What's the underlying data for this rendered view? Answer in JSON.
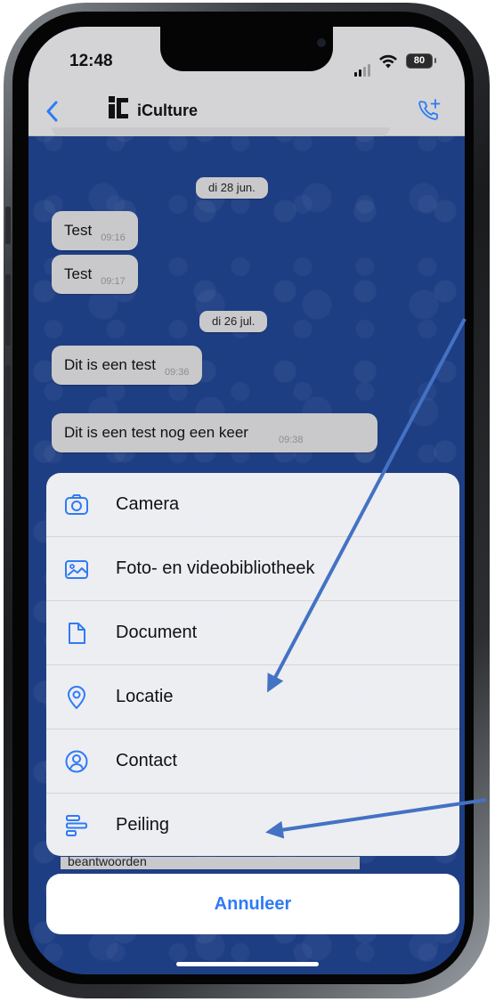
{
  "status_bar": {
    "time": "12:48",
    "battery": "80"
  },
  "chat": {
    "title": "iCulture",
    "messages": [
      {
        "type": "date",
        "text": "di 28 jun."
      },
      {
        "type": "message",
        "text": "Test",
        "time": "09:16"
      },
      {
        "type": "message",
        "text": "Test",
        "time": "09:17"
      },
      {
        "type": "date",
        "text": "di 26 jul."
      },
      {
        "type": "message",
        "text": "Dit is een test",
        "time": "09:36"
      },
      {
        "type": "message",
        "text": "Dit is een test nog een keer",
        "time": "09:38"
      }
    ],
    "partial_message": "beantwoorden"
  },
  "action_sheet": {
    "items": [
      {
        "label": "Camera",
        "icon": "camera-icon"
      },
      {
        "label": "Foto- en videobibliotheek",
        "icon": "photo-library-icon"
      },
      {
        "label": "Document",
        "icon": "document-icon"
      },
      {
        "label": "Locatie",
        "icon": "location-pin-icon"
      },
      {
        "label": "Contact",
        "icon": "contact-icon"
      },
      {
        "label": "Peiling",
        "icon": "poll-icon"
      }
    ],
    "cancel_label": "Annuleer"
  },
  "colors": {
    "accent": "#2f7bf5",
    "chat_background": "#1e3e84",
    "bubble": "#c9c9cc",
    "annotation_arrow": "#4472c4"
  }
}
